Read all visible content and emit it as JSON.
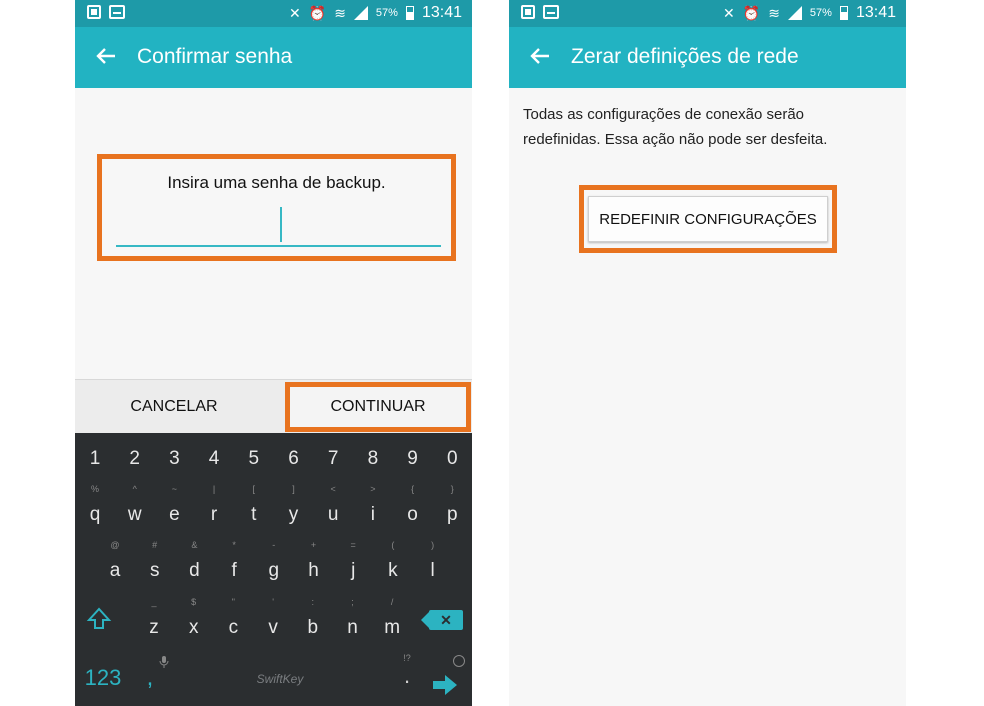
{
  "status_bar": {
    "battery": "57%",
    "time": "13:41"
  },
  "left_screen": {
    "title": "Confirmar senha",
    "prompt": "Insira uma senha de backup.",
    "cancel_label": "CANCELAR",
    "continue_label": "CONTINUAR",
    "keyboard": {
      "number_row": [
        "1",
        "2",
        "3",
        "4",
        "5",
        "6",
        "7",
        "8",
        "9",
        "0"
      ],
      "row1": [
        "q",
        "w",
        "e",
        "r",
        "t",
        "y",
        "u",
        "i",
        "o",
        "p"
      ],
      "row1_hints": [
        "%",
        "^",
        "~",
        "|",
        "[",
        "]",
        "<",
        ">",
        "{",
        "}"
      ],
      "row2": [
        "a",
        "s",
        "d",
        "f",
        "g",
        "h",
        "j",
        "k",
        "l"
      ],
      "row2_hints": [
        "@",
        "#",
        "&",
        "*",
        "-",
        "+",
        "=",
        "(",
        ")"
      ],
      "row3": [
        "z",
        "x",
        "c",
        "v",
        "b",
        "n",
        "m"
      ],
      "row3_hints": [
        "_",
        "$",
        "\"",
        "'",
        ":",
        ";",
        "/"
      ],
      "symbols_label": "123",
      "comma": ",",
      "period": ".",
      "period_hint": "!?",
      "space_label": "SwiftKey",
      "backspace_label": "✕"
    }
  },
  "right_screen": {
    "title": "Zerar definições de rede",
    "description": "Todas as configurações de conexão serão redefinidas. Essa ação não pode ser desfeita.",
    "reset_label": "REDEFINIR CONFIGURAÇÕES"
  },
  "colors": {
    "status_bar": "#1e9aa8",
    "app_bar": "#22b3c2",
    "highlight": "#e8731f",
    "keyboard_bg": "#2b2e30",
    "accent": "#2cb3c1"
  }
}
